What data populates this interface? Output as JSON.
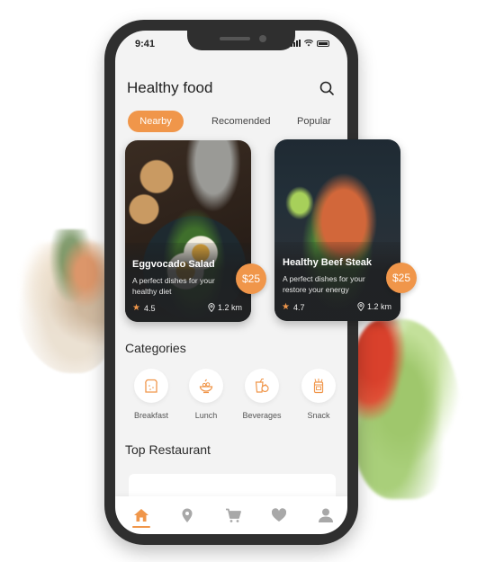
{
  "status_bar": {
    "time": "9:41"
  },
  "header": {
    "title": "Healthy food",
    "search_icon": "search-icon"
  },
  "tabs": [
    {
      "label": "Nearby",
      "active": true
    },
    {
      "label": "Recomended",
      "active": false
    },
    {
      "label": "Popular",
      "active": false
    }
  ],
  "food_cards": [
    {
      "name": "Eggvocado Salad",
      "description": "A perfect dishes for your healthy diet",
      "rating": "4.5",
      "distance": "1.2 km",
      "price": "$25"
    },
    {
      "name": "Healthy Beef Steak",
      "description": "A perfect dishes for your restore your energy",
      "rating": "4.7",
      "distance": "1.2 km",
      "price": "$25"
    }
  ],
  "categories": {
    "title": "Categories",
    "items": [
      {
        "label": "Breakfast",
        "icon": "bread-icon"
      },
      {
        "label": "Lunch",
        "icon": "bowl-icon"
      },
      {
        "label": "Beverages",
        "icon": "drink-icon"
      },
      {
        "label": "Snack",
        "icon": "snack-jar-icon"
      }
    ]
  },
  "top_restaurant": {
    "title": "Top Restaurant"
  },
  "bottom_nav": [
    {
      "icon": "home-icon",
      "active": true
    },
    {
      "icon": "location-icon",
      "active": false
    },
    {
      "icon": "cart-icon",
      "active": false
    },
    {
      "icon": "heart-icon",
      "active": false
    },
    {
      "icon": "profile-icon",
      "active": false
    }
  ],
  "colors": {
    "accent": "#f0964a",
    "inactive_icon": "#a8a8a8",
    "frame": "#2f2f2f",
    "screen_bg": "#f3f3f3"
  }
}
